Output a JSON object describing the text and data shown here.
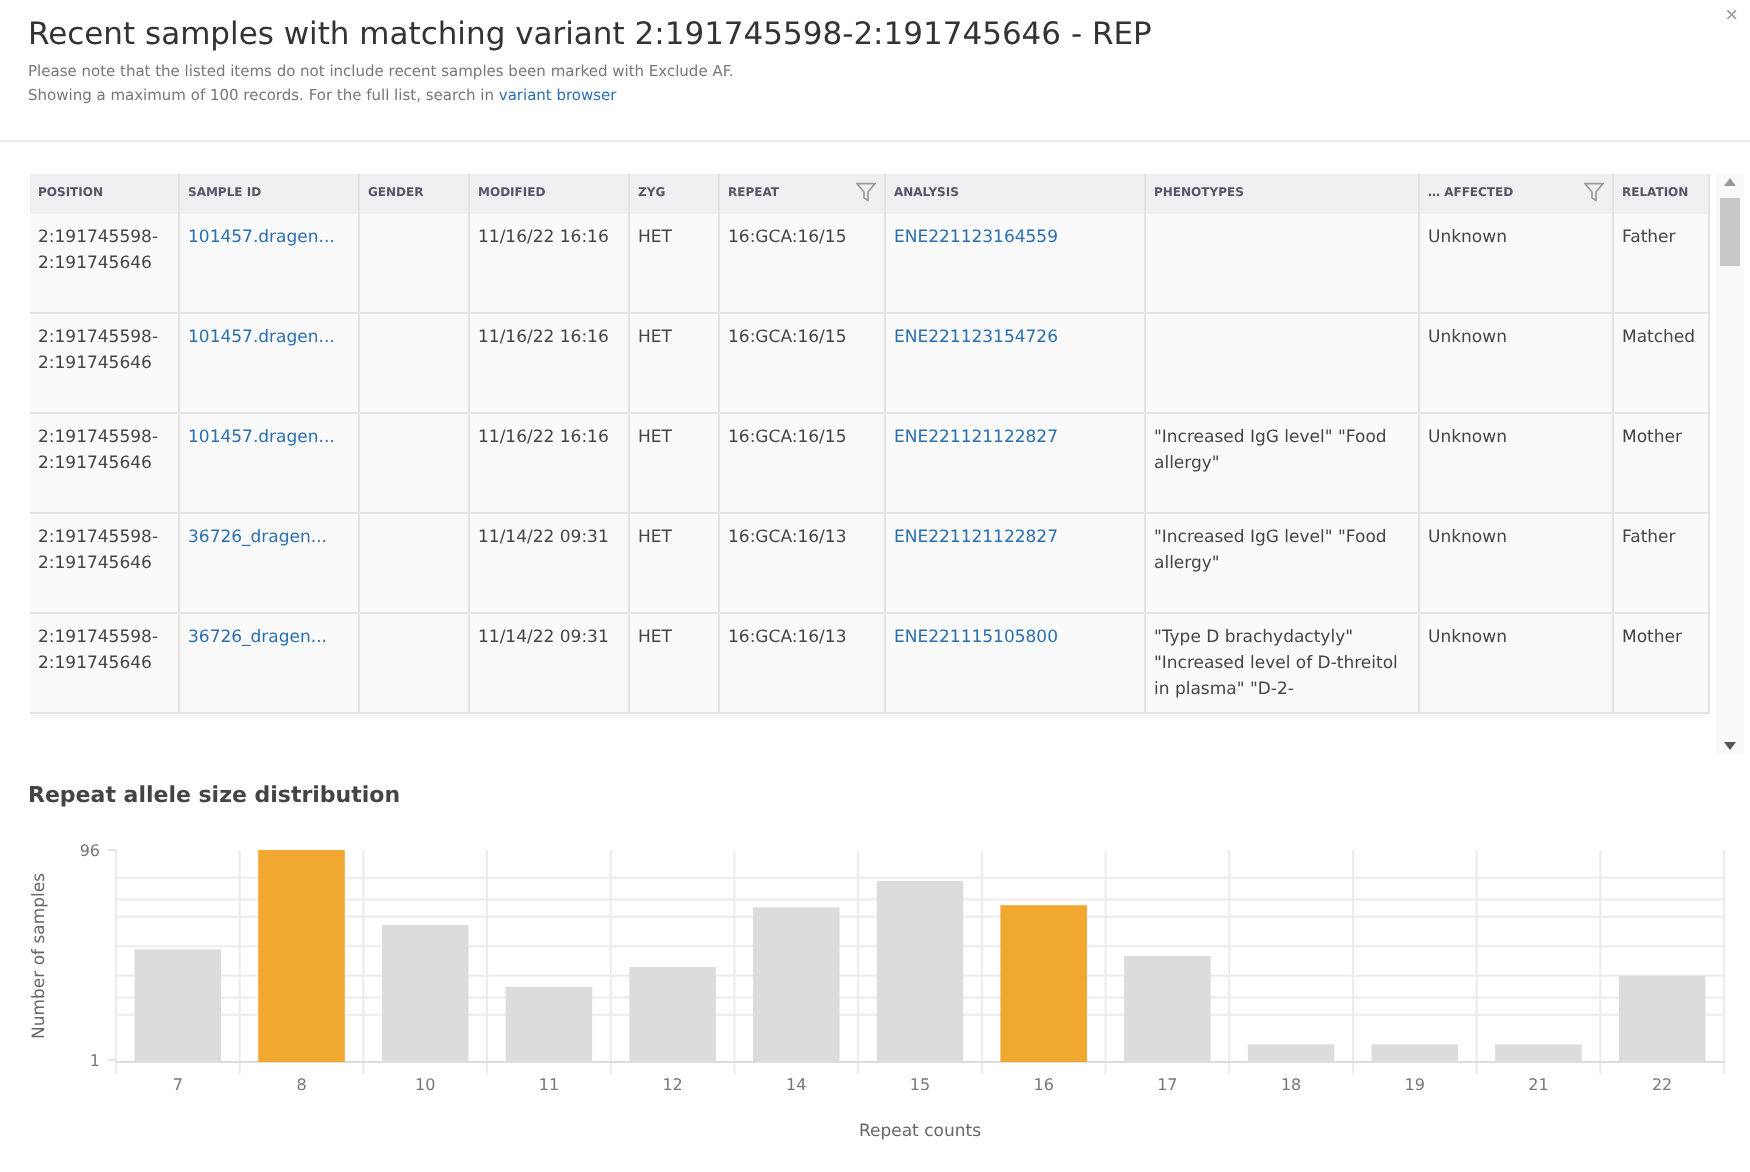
{
  "dialog": {
    "title": "Recent samples with matching variant 2:191745598-2:191745646 - REP",
    "close": "×",
    "notes": [
      "Please note that the listed items do not include recent samples been marked with Exclude AF."
    ],
    "limit_note": "Showing a maximum of 100 records. For the full list, search in ",
    "limit_link": "variant browser"
  },
  "table": {
    "columns": [
      {
        "label": "POSITION",
        "kind": "text",
        "filter": false
      },
      {
        "label": "SAMPLE ID",
        "kind": "link",
        "filter": false
      },
      {
        "label": "GENDER",
        "kind": "text",
        "filter": false
      },
      {
        "label": "MODIFIED",
        "kind": "text",
        "filter": false
      },
      {
        "label": "ZYG",
        "kind": "text",
        "filter": false
      },
      {
        "label": "REPEAT",
        "kind": "text",
        "filter": true
      },
      {
        "label": "ANALYSIS",
        "kind": "link",
        "filter": false
      },
      {
        "label": "PHENOTYPES",
        "kind": "text",
        "filter": false
      },
      {
        "label": "… AFFECTED",
        "kind": "text",
        "filter": true
      },
      {
        "label": "RELATION",
        "kind": "text",
        "filter": false
      }
    ],
    "rows": [
      {
        "cells": [
          "2:191745598-2:191745646",
          "101457.dragen...",
          "",
          "11/16/22 16:16",
          "HET",
          "16:GCA:16/15",
          "ENE221123164559",
          "",
          "Unknown",
          "Father"
        ]
      },
      {
        "cells": [
          "2:191745598-2:191745646",
          "101457.dragen...",
          "",
          "11/16/22 16:16",
          "HET",
          "16:GCA:16/15",
          "ENE221123154726",
          "",
          "Unknown",
          "Matched"
        ]
      },
      {
        "cells": [
          "2:191745598-2:191745646",
          "101457.dragen...",
          "",
          "11/16/22 16:16",
          "HET",
          "16:GCA:16/15",
          "ENE221121122827",
          "\"Increased IgG level\" \"Food allergy\"",
          "Unknown",
          "Mother"
        ]
      },
      {
        "cells": [
          "2:191745598-2:191745646",
          "36726_dragen...",
          "",
          "11/14/22 09:31",
          "HET",
          "16:GCA:16/13",
          "ENE221121122827",
          "\"Increased IgG level\" \"Food allergy\"",
          "Unknown",
          "Father"
        ]
      },
      {
        "cells": [
          "2:191745598-2:191745646",
          "36726_dragen...",
          "",
          "11/14/22 09:31",
          "HET",
          "16:GCA:16/13",
          "ENE221115105800",
          "\"Type D brachydactyly\" \"Increased level of D-threitol in plasma\" \"D-2-",
          "Unknown",
          "Mother"
        ]
      }
    ]
  },
  "distribution": {
    "title": "Repeat allele size distribution",
    "chart_data": {
      "type": "bar",
      "xlabel": "Repeat counts",
      "ylabel": "Number of samples",
      "categories": [
        "7",
        "8",
        "10",
        "11",
        "12",
        "14",
        "15",
        "16",
        "17",
        "18",
        "19",
        "21",
        "22"
      ],
      "ylim": [
        0,
        96
      ],
      "yticks": [
        1,
        96
      ],
      "series": [
        {
          "color": "#dcdcdc",
          "values": [
            51,
            null,
            62,
            34,
            43,
            70,
            82,
            null,
            48,
            8,
            8,
            8,
            39
          ]
        },
        {
          "color": "#f0a830",
          "values": [
            null,
            96,
            null,
            null,
            null,
            null,
            null,
            71,
            null,
            null,
            null,
            null,
            null
          ]
        }
      ]
    }
  }
}
